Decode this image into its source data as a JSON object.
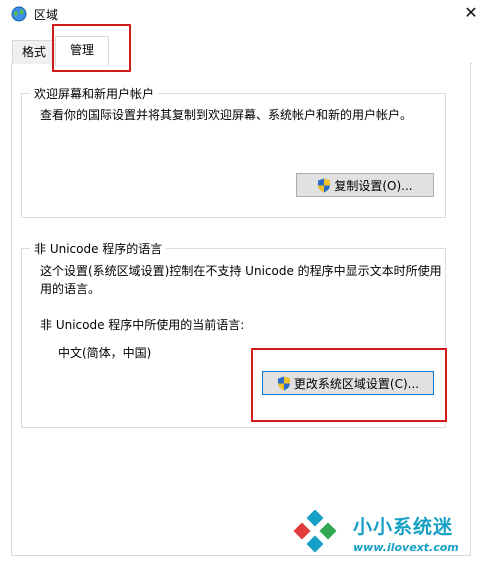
{
  "window": {
    "title": "区域"
  },
  "tabs": [
    {
      "label": "格式"
    },
    {
      "label": "管理"
    }
  ],
  "welcome_group": {
    "title": "欢迎屏幕和新用户帐户",
    "description": "查看你的国际设置并将其复制到欢迎屏幕、系统帐户和新的用户帐户。",
    "copy_button_label": "复制设置(O)..."
  },
  "nonunicode_group": {
    "title": "非 Unicode 程序的语言",
    "description_line1": "这个设置(系统区域设置)控制在不支持 Unicode 的程序中显示文本时所使用",
    "description_line2": "用的语言。",
    "current_label": "非 Unicode 程序中所使用的当前语言:",
    "current_value": "中文(简体，中国)",
    "change_button_label": "更改系统区域设置(C)..."
  },
  "watermark": {
    "name": "小小系统迷",
    "url": "www.ilovext.com"
  },
  "colors": {
    "highlight": "#d01b1b",
    "accent": "#0078d7",
    "watermark": "#17a0c6"
  }
}
